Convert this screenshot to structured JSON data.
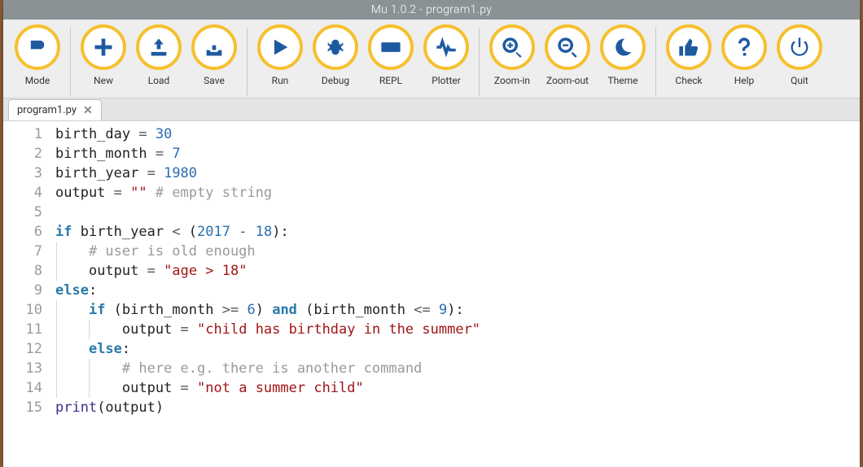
{
  "window": {
    "title": "Mu 1.0.2 - program1.py"
  },
  "toolbar": {
    "groups": [
      {
        "items": [
          {
            "name": "mode-button",
            "icon": "mode-icon",
            "label": "Mode"
          }
        ]
      },
      {
        "items": [
          {
            "name": "new-button",
            "icon": "plus-icon",
            "label": "New"
          },
          {
            "name": "load-button",
            "icon": "load-icon",
            "label": "Load"
          },
          {
            "name": "save-button",
            "icon": "save-icon",
            "label": "Save"
          }
        ]
      },
      {
        "items": [
          {
            "name": "run-button",
            "icon": "play-icon",
            "label": "Run"
          },
          {
            "name": "debug-button",
            "icon": "bug-icon",
            "label": "Debug"
          },
          {
            "name": "repl-button",
            "icon": "keyboard-icon",
            "label": "REPL"
          },
          {
            "name": "plotter-button",
            "icon": "pulse-icon",
            "label": "Plotter"
          }
        ]
      },
      {
        "items": [
          {
            "name": "zoom-in-button",
            "icon": "zoom-in-icon",
            "label": "Zoom-in"
          },
          {
            "name": "zoom-out-button",
            "icon": "zoom-out-icon",
            "label": "Zoom-out"
          },
          {
            "name": "theme-button",
            "icon": "moon-icon",
            "label": "Theme"
          }
        ]
      },
      {
        "items": [
          {
            "name": "check-button",
            "icon": "thumb-icon",
            "label": "Check"
          },
          {
            "name": "help-button",
            "icon": "question-icon",
            "label": "Help"
          },
          {
            "name": "quit-button",
            "icon": "power-icon",
            "label": "Quit"
          }
        ]
      }
    ]
  },
  "tab": {
    "label": "program1.py"
  },
  "code": {
    "lines": [
      {
        "n": 1,
        "tokens": [
          [
            "var",
            "birth_day"
          ],
          [
            "op",
            " = "
          ],
          [
            "num",
            "30"
          ]
        ]
      },
      {
        "n": 2,
        "tokens": [
          [
            "var",
            "birth_month"
          ],
          [
            "op",
            " = "
          ],
          [
            "num",
            "7"
          ]
        ]
      },
      {
        "n": 3,
        "tokens": [
          [
            "var",
            "birth_year"
          ],
          [
            "op",
            " = "
          ],
          [
            "num",
            "1980"
          ]
        ]
      },
      {
        "n": 4,
        "tokens": [
          [
            "var",
            "output"
          ],
          [
            "op",
            " = "
          ],
          [
            "str",
            "\"\""
          ],
          [
            "var",
            " "
          ],
          [
            "cmt",
            "# empty string"
          ]
        ]
      },
      {
        "n": 5,
        "tokens": []
      },
      {
        "n": 6,
        "tokens": [
          [
            "kw",
            "if"
          ],
          [
            "var",
            " birth_year "
          ],
          [
            "op",
            "<"
          ],
          [
            "var",
            " ("
          ],
          [
            "num",
            "2017"
          ],
          [
            "var",
            " "
          ],
          [
            "op",
            "-"
          ],
          [
            "var",
            " "
          ],
          [
            "num",
            "18"
          ],
          [
            "var",
            "):"
          ]
        ]
      },
      {
        "n": 7,
        "indent": 1,
        "tokens": [
          [
            "cmt",
            "# user is old enough"
          ]
        ]
      },
      {
        "n": 8,
        "indent": 1,
        "tokens": [
          [
            "var",
            "output "
          ],
          [
            "op",
            "="
          ],
          [
            "var",
            " "
          ],
          [
            "str",
            "\"age > 18\""
          ]
        ]
      },
      {
        "n": 9,
        "tokens": [
          [
            "kw",
            "else"
          ],
          [
            "var",
            ":"
          ]
        ]
      },
      {
        "n": 10,
        "indent": 1,
        "tokens": [
          [
            "kw",
            "if"
          ],
          [
            "var",
            " (birth_month "
          ],
          [
            "op",
            ">="
          ],
          [
            "var",
            " "
          ],
          [
            "num",
            "6"
          ],
          [
            "var",
            ") "
          ],
          [
            "kw",
            "and"
          ],
          [
            "var",
            " (birth_month "
          ],
          [
            "op",
            "<="
          ],
          [
            "var",
            " "
          ],
          [
            "num",
            "9"
          ],
          [
            "var",
            "):"
          ]
        ]
      },
      {
        "n": 11,
        "indent": 2,
        "tokens": [
          [
            "var",
            "output "
          ],
          [
            "op",
            "="
          ],
          [
            "var",
            " "
          ],
          [
            "str",
            "\"child has birthday in the summer\""
          ]
        ]
      },
      {
        "n": 12,
        "indent": 1,
        "tokens": [
          [
            "kw",
            "else"
          ],
          [
            "var",
            ":"
          ]
        ]
      },
      {
        "n": 13,
        "indent": 2,
        "tokens": [
          [
            "cmt",
            "# here e.g. there is another command"
          ]
        ]
      },
      {
        "n": 14,
        "indent": 2,
        "tokens": [
          [
            "var",
            "output "
          ],
          [
            "op",
            "="
          ],
          [
            "var",
            " "
          ],
          [
            "str",
            "\"not a summer child\""
          ]
        ]
      },
      {
        "n": 15,
        "tokens": [
          [
            "fn",
            "print"
          ],
          [
            "var",
            "(output)"
          ]
        ]
      }
    ]
  }
}
